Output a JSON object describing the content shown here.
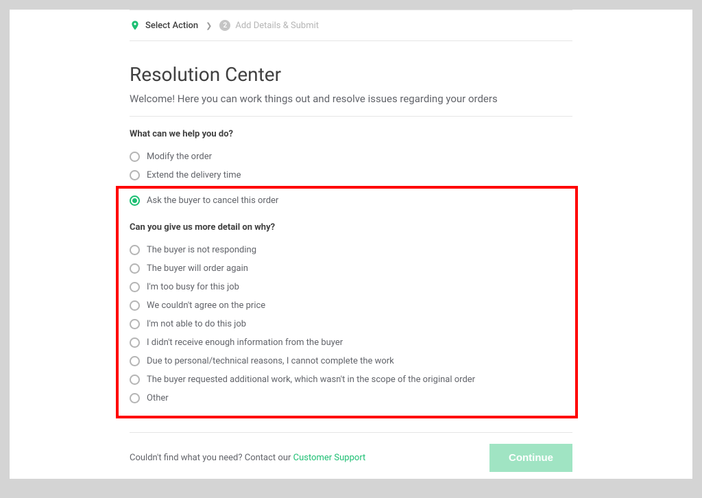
{
  "steps": {
    "step1": {
      "label": "Select Action"
    },
    "step2": {
      "number": "2",
      "label": "Add Details & Submit"
    }
  },
  "title": "Resolution Center",
  "welcome": "Welcome! Here you can work things out and resolve issues regarding your orders",
  "question1": {
    "heading": "What can we help you do?",
    "options": [
      "Modify the order",
      "Extend the delivery time",
      "Ask the buyer to cancel this order"
    ],
    "selected_index": 2
  },
  "question2": {
    "heading": "Can you give us more detail on why?",
    "options": [
      "The buyer is not responding",
      "The buyer will order again",
      "I'm too busy for this job",
      "We couldn't agree on the price",
      "I'm not able to do this job",
      "I didn't receive enough information from the buyer",
      "Due to personal/technical reasons, I cannot complete the work",
      "The buyer requested additional work, which wasn't in the scope of the original order",
      "Other"
    ]
  },
  "footer": {
    "prefix": "Couldn't find what you need? Contact our ",
    "link": "Customer Support"
  },
  "continue_label": "Continue"
}
